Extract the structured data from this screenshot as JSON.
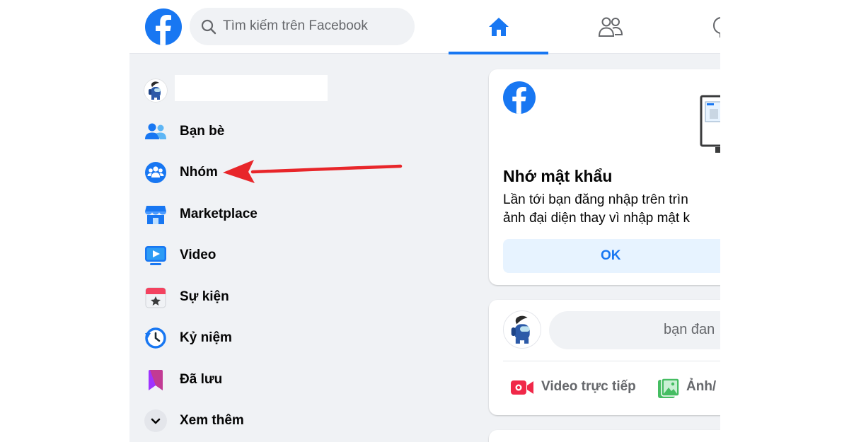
{
  "topbar": {
    "search_placeholder": "Tìm kiếm trên Facebook",
    "tabs": [
      {
        "name": "home",
        "icon": "home-icon",
        "active": true
      },
      {
        "name": "friends",
        "icon": "friends-icon",
        "active": false
      },
      {
        "name": "chat",
        "icon": "chat-icon",
        "active": false
      }
    ]
  },
  "sidebar": {
    "profile_name": "",
    "items": [
      {
        "label": "Bạn bè",
        "icon": "friends-icon"
      },
      {
        "label": "Nhóm",
        "icon": "groups-icon"
      },
      {
        "label": "Marketplace",
        "icon": "marketplace-icon"
      },
      {
        "label": "Video",
        "icon": "video-icon"
      },
      {
        "label": "Sự kiện",
        "icon": "events-icon"
      },
      {
        "label": "Kỷ niệm",
        "icon": "memories-icon"
      },
      {
        "label": "Đã lưu",
        "icon": "saved-icon"
      },
      {
        "label": "Xem thêm",
        "icon": "chevron-down-icon"
      }
    ]
  },
  "remember_card": {
    "title": "Nhớ mật khẩu",
    "desc_line1": "Lần tới bạn đăng nhập trên trìn",
    "desc_line2": "ảnh đại diện thay vì nhập mật k",
    "ok_label": "OK"
  },
  "composer": {
    "placeholder": "bạn đan",
    "actions": [
      {
        "label": "Video trực tiếp",
        "icon": "live-video-icon"
      },
      {
        "label": "Ảnh/",
        "icon": "photo-icon"
      }
    ]
  },
  "colors": {
    "brand": "#1877f2",
    "annotation_arrow": "#e8262a",
    "page_bg": "#f0f2f5"
  }
}
